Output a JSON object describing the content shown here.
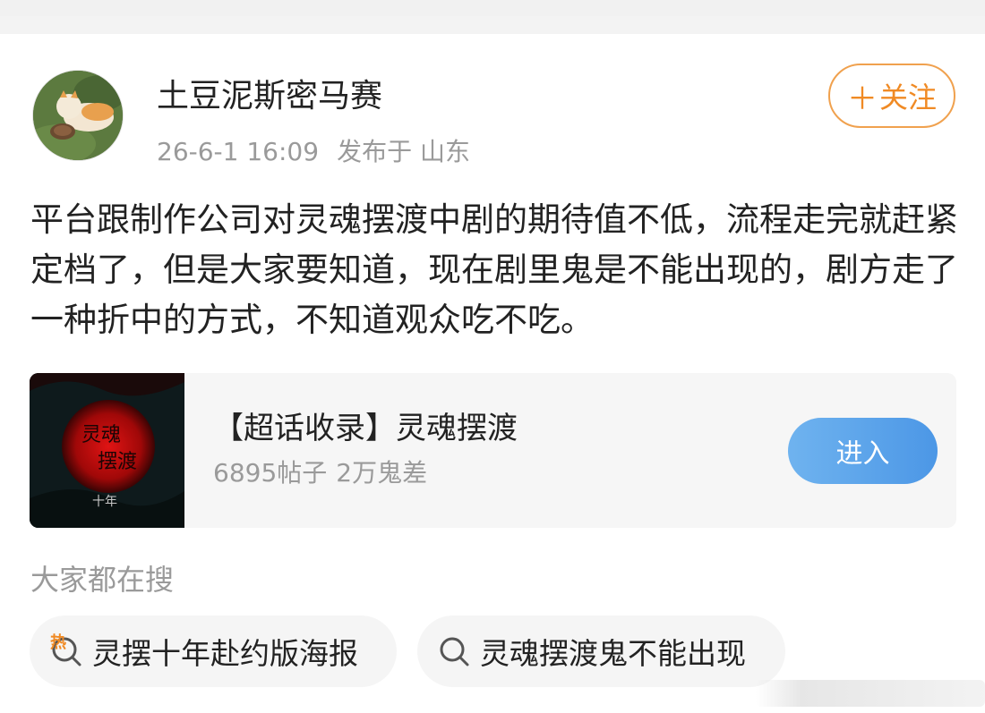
{
  "post": {
    "username": "土豆泥斯密马赛",
    "date": "26-6-1 16:09",
    "location": "发布于 山东",
    "follow_label": "关注",
    "text": "平台跟制作公司对灵魂摆渡中剧的期待值不低，流程走完就赶紧定档了，但是大家要知道，现在剧里鬼是不能出现的，剧方走了一种折中的方式，不知道观众吃不吃。"
  },
  "topic": {
    "title": "【超话收录】灵魂摆渡",
    "posts": "6895帖子",
    "members": "2万鬼差",
    "enter_label": "进入",
    "poster_text": {
      "title_top": "灵魂",
      "title_bottom": "摆渡",
      "subtitle": "十年"
    }
  },
  "trending": {
    "label": "大家都在搜",
    "items": [
      {
        "text": "灵摆十年赴约版海报",
        "badge": "热"
      },
      {
        "text": "灵魂摆渡鬼不能出现",
        "badge": ""
      }
    ]
  },
  "colors": {
    "accent_orange": "#f08a24",
    "button_blue": "#4c97e6",
    "muted_gray": "#9a9a9a"
  }
}
